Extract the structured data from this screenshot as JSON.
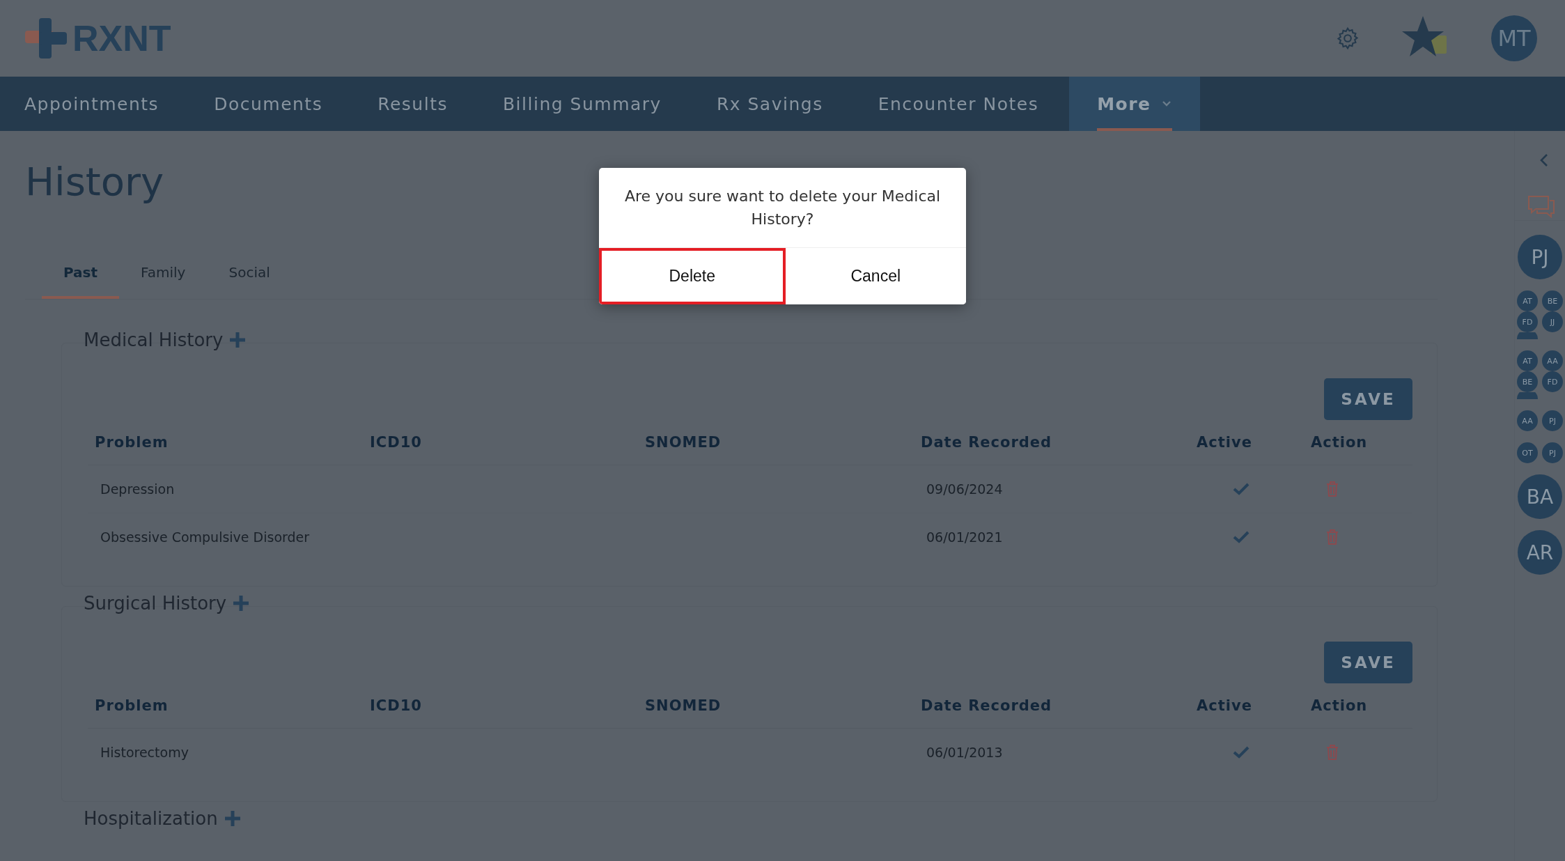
{
  "header": {
    "logo": "RXNT",
    "user_initials": "MT"
  },
  "nav": [
    {
      "label": "Appointments",
      "selected": false,
      "dropdown": false
    },
    {
      "label": "Documents",
      "selected": false,
      "dropdown": false
    },
    {
      "label": "Results",
      "selected": false,
      "dropdown": false
    },
    {
      "label": "Billing Summary",
      "selected": false,
      "dropdown": false
    },
    {
      "label": "Rx Savings",
      "selected": false,
      "dropdown": false
    },
    {
      "label": "Encounter Notes",
      "selected": false,
      "dropdown": false
    },
    {
      "label": "More",
      "selected": true,
      "dropdown": true
    }
  ],
  "page_title": "History",
  "tabs": [
    {
      "label": "Past",
      "selected": true
    },
    {
      "label": "Family",
      "selected": false
    },
    {
      "label": "Social",
      "selected": false
    }
  ],
  "sections": [
    {
      "title": "Medical History",
      "save_label": "SAVE",
      "columns": [
        "Problem",
        "ICD10",
        "SNOMED",
        "Date Recorded",
        "Active",
        "Action"
      ],
      "rows": [
        {
          "problem": "Depression",
          "date": "09/06/2024",
          "active": true
        },
        {
          "problem": "Obsessive Compulsive Disorder",
          "date": "06/01/2021",
          "active": true
        }
      ]
    },
    {
      "title": "Surgical History",
      "save_label": "SAVE",
      "columns": [
        "Problem",
        "ICD10",
        "SNOMED",
        "Date Recorded",
        "Active",
        "Action"
      ],
      "rows": [
        {
          "problem": "Historectomy",
          "date": "06/01/2013",
          "active": true
        }
      ]
    },
    {
      "title": "Hospitalization"
    }
  ],
  "sidebar": [
    {
      "kind": "single",
      "initials": [
        "PJ"
      ]
    },
    {
      "kind": "group",
      "initials": [
        "AT",
        "BE",
        "FD",
        "JJ"
      ],
      "more": true
    },
    {
      "kind": "group",
      "initials": [
        "AT",
        "AA",
        "BE",
        "FD"
      ],
      "more": true
    },
    {
      "kind": "group",
      "initials": [
        "AA",
        "PJ"
      ],
      "more": false
    },
    {
      "kind": "group",
      "initials": [
        "OT",
        "PJ"
      ],
      "more": false
    },
    {
      "kind": "single",
      "initials": [
        "BA"
      ]
    },
    {
      "kind": "single",
      "initials": [
        "AR"
      ]
    }
  ],
  "dialog": {
    "message": "Are you sure want to delete your Medical History?",
    "buttons": [
      {
        "label": "Delete",
        "focused": true
      },
      {
        "label": "Cancel",
        "focused": false
      }
    ]
  }
}
